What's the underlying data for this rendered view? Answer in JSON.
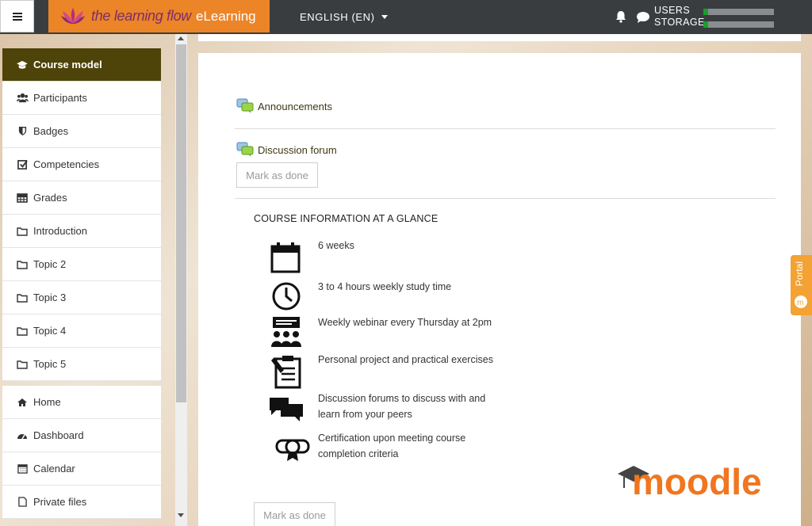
{
  "header": {
    "brand_part1": "the learning flow",
    "brand_part2": "eLearning",
    "language": "ENGLISH (EN)",
    "usage_users": "USERS",
    "usage_storage": "STORAGE",
    "usage_users_fraction": 0.07,
    "usage_storage_fraction": 0.07,
    "brand_color": "#ec8428"
  },
  "sidebar": {
    "items": [
      {
        "label": "Course model",
        "icon": "graduation-cap-icon",
        "active": true
      },
      {
        "label": "Participants",
        "icon": "users-icon"
      },
      {
        "label": "Badges",
        "icon": "shield-icon"
      },
      {
        "label": "Competencies",
        "icon": "check-square-icon"
      },
      {
        "label": "Grades",
        "icon": "table-icon"
      },
      {
        "label": "Introduction",
        "icon": "folder-icon"
      },
      {
        "label": "Topic 2",
        "icon": "folder-icon"
      },
      {
        "label": "Topic 3",
        "icon": "folder-icon"
      },
      {
        "label": "Topic 4",
        "icon": "folder-icon"
      },
      {
        "label": "Topic 5",
        "icon": "folder-icon"
      }
    ],
    "items2": [
      {
        "label": "Home",
        "icon": "home-icon"
      },
      {
        "label": "Dashboard",
        "icon": "dashboard-icon"
      },
      {
        "label": "Calendar",
        "icon": "calendar-icon"
      },
      {
        "label": "Private files",
        "icon": "file-icon"
      }
    ],
    "active_color": "#4e4308"
  },
  "main": {
    "announcements": "Announcements",
    "discussion_forum": "Discussion forum",
    "mark_as_done": "Mark as done",
    "glance_title": "COURSE INFORMATION AT A GLANCE",
    "info": [
      {
        "text": "6 weeks",
        "icon": "calendar-icon"
      },
      {
        "text": "3 to 4 hours weekly study time",
        "icon": "clock-icon"
      },
      {
        "text": "Weekly webinar every Thursday at 2pm",
        "icon": "webinar-icon"
      },
      {
        "text": "Personal project and practical exercises",
        "icon": "clipboard-icon"
      },
      {
        "text": "Discussion forums to discuss with and learn from your peers",
        "icon": "chat-bubbles-icon"
      },
      {
        "text": "Certification upon meeting course completion criteria",
        "icon": "certificate-icon"
      }
    ],
    "moodle_logo": "moodle"
  },
  "portal_tab": "Portal"
}
